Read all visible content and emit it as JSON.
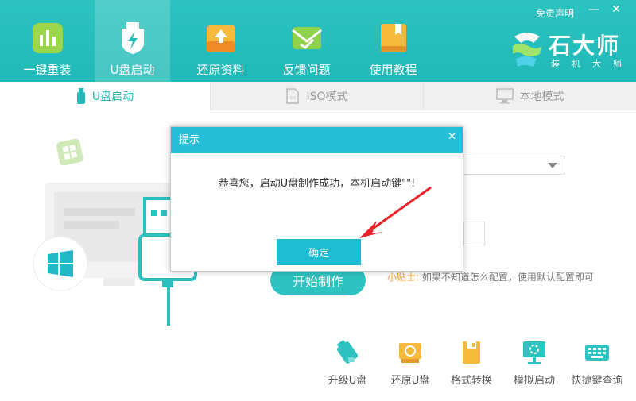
{
  "header": {
    "nav": [
      {
        "label": "一键重装",
        "icon": "bar-chart-icon"
      },
      {
        "label": "U盘启动",
        "icon": "usb-shield-icon"
      },
      {
        "label": "还原资料",
        "icon": "restore-box-icon"
      },
      {
        "label": "反馈问题",
        "icon": "envelope-icon"
      },
      {
        "label": "使用教程",
        "icon": "book-icon"
      }
    ],
    "disclaimer": "免责声明",
    "minimize": "—",
    "close": "✕",
    "brand": {
      "name": "石大师",
      "sub": "装机大师"
    },
    "accent": "#22bcbb"
  },
  "subtabs": [
    {
      "label": "U盘启动",
      "icon": "usb-icon"
    },
    {
      "label": "ISO模式",
      "icon": "iso-file-icon"
    },
    {
      "label": "本地模式",
      "icon": "monitor-icon"
    }
  ],
  "main": {
    "start_button": "开始制作",
    "tip_label": "小贴士:",
    "tip_text": "如果不知道怎么配置，使用默认配置即可"
  },
  "tools": [
    {
      "label": "升级U盘",
      "icon": "usb-upgrade-icon"
    },
    {
      "label": "还原U盘",
      "icon": "usb-restore-icon"
    },
    {
      "label": "格式转换",
      "icon": "format-convert-icon"
    },
    {
      "label": "模拟启动",
      "icon": "simulate-boot-icon"
    },
    {
      "label": "快捷键查询",
      "icon": "keyboard-icon"
    }
  ],
  "dialog": {
    "title": "提示",
    "close": "✕",
    "message": "恭喜您，启动U盘制作成功，本机启动键\"\"!",
    "ok_button": "确定"
  }
}
